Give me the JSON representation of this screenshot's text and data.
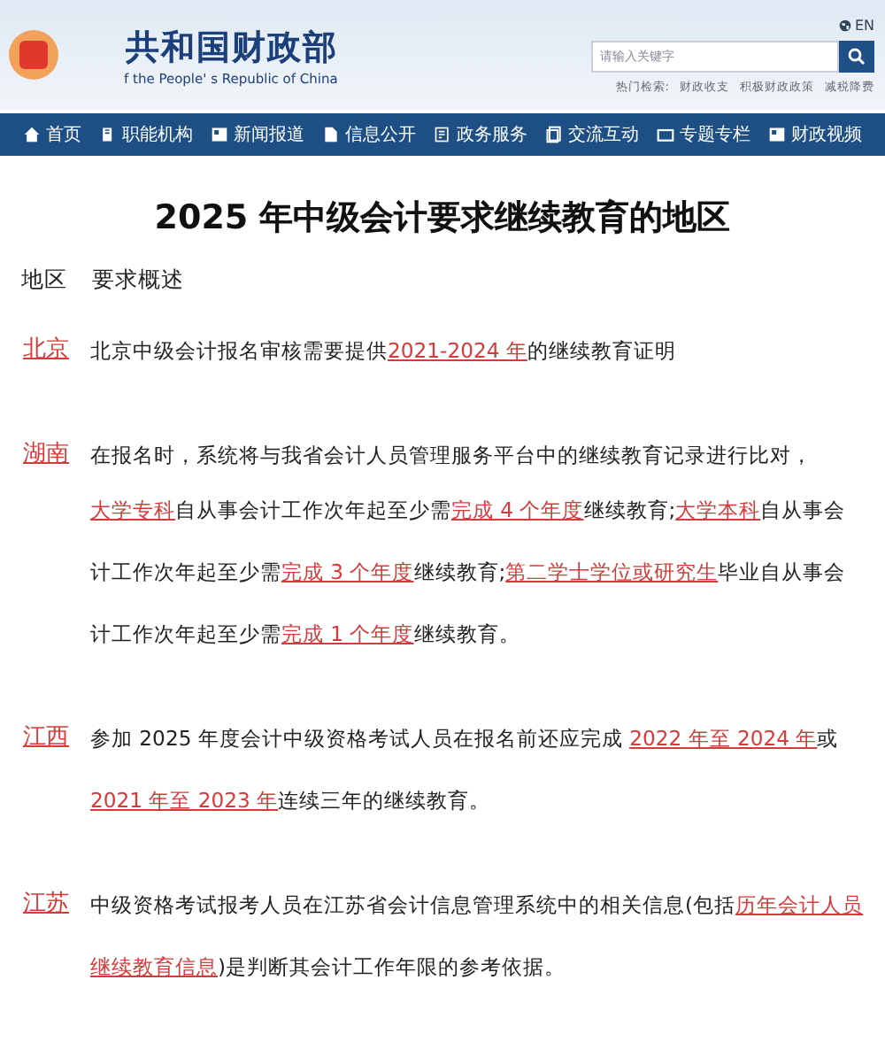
{
  "header": {
    "site_name": "共和国财政部",
    "site_name_en": "f the People' s Republic of China",
    "language": "EN",
    "search": {
      "placeholder": "请输入关键字"
    },
    "hot_label": "热门检索:",
    "hot_links": [
      "财政收支",
      "积极财政政策",
      "减税降费"
    ]
  },
  "nav": [
    {
      "label": "首页"
    },
    {
      "label": "职能机构"
    },
    {
      "label": "新闻报道"
    },
    {
      "label": "信息公开"
    },
    {
      "label": "政务服务"
    },
    {
      "label": "交流互动"
    },
    {
      "label": "专题专栏"
    },
    {
      "label": "财政视频"
    }
  ],
  "article": {
    "title": "2025 年中级会计要求继续教育的地区",
    "columns": [
      "地区",
      "要求概述"
    ],
    "rows": [
      {
        "region": "北京",
        "paragraphs": [
          [
            {
              "text": "北京中级会计报名审核需要提供",
              "emphasis": false
            },
            {
              "text": "2021-2024 年",
              "emphasis": true
            },
            {
              "text": "的继续教育证明",
              "emphasis": false
            }
          ]
        ]
      },
      {
        "region": "湖南",
        "paragraphs": [
          [
            {
              "text": "在报名时，系统将与我省会计人员管理服务平台中的继续教育记录进行比对，",
              "emphasis": false
            }
          ],
          [
            {
              "text": "大学专科",
              "emphasis": true
            },
            {
              "text": "自从事会计工作次年起至少需",
              "emphasis": false
            },
            {
              "text": "完成 4 个年度",
              "emphasis": true
            },
            {
              "text": "继续教育;",
              "emphasis": false
            },
            {
              "text": "大学本科",
              "emphasis": true
            },
            {
              "text": "自从事会计工作次年起至少需",
              "emphasis": false
            },
            {
              "text": "完成 3 个年度",
              "emphasis": true
            },
            {
              "text": "继续教育;",
              "emphasis": false
            },
            {
              "text": "第二学士学位或研究生",
              "emphasis": true
            },
            {
              "text": "毕业自从事会计工作次年起至少需",
              "emphasis": false
            },
            {
              "text": "完成 1 个年度",
              "emphasis": true
            },
            {
              "text": "继续教育。",
              "emphasis": false
            }
          ]
        ]
      },
      {
        "region": "江西",
        "paragraphs": [
          [
            {
              "text": "参加 2025 年度会计中级资格考试人员在报名前还应完成 ",
              "emphasis": false
            },
            {
              "text": "2022 年至 2024 年",
              "emphasis": true
            },
            {
              "text": "或 ",
              "emphasis": false
            },
            {
              "text": "2021 年至 2023 年",
              "emphasis": true
            },
            {
              "text": "连续三年的继续教育。",
              "emphasis": false
            }
          ]
        ]
      },
      {
        "region": "江苏",
        "paragraphs": [
          [
            {
              "text": "中级资格考试报考人员在江苏省会计信息管理系统中的相关信息(包括",
              "emphasis": false
            },
            {
              "text": "历年会计人员继续教育信息",
              "emphasis": true
            },
            {
              "text": ")是判断其会计工作年限的参考依据。",
              "emphasis": false
            }
          ]
        ]
      }
    ]
  }
}
